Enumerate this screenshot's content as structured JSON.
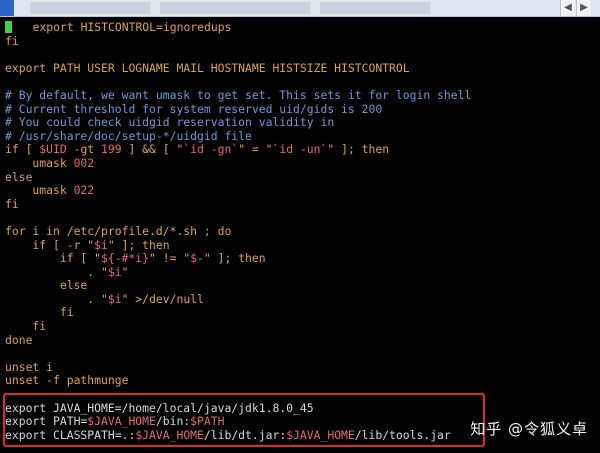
{
  "tabbar": {
    "nav_prev": "◀",
    "nav_next": "▶"
  },
  "terminal": {
    "lines": [
      [
        {
          "t": "   export HISTCONTROL=ignoredups",
          "c": "kw"
        }
      ],
      [
        {
          "t": "fi",
          "c": "kw"
        }
      ],
      [
        {
          "t": "",
          "c": "txt"
        }
      ],
      [
        {
          "t": "export PATH USER LOGNAME MAIL HOSTNAME HISTSIZE HISTCONTROL",
          "c": "kw"
        }
      ],
      [
        {
          "t": "",
          "c": "txt"
        }
      ],
      [
        {
          "t": "# By default, we want umask to get set. This sets it for login shell",
          "c": "cmt"
        }
      ],
      [
        {
          "t": "# Current threshold for system reserved uid/gids is 200",
          "c": "cmt"
        }
      ],
      [
        {
          "t": "# You could check uidgid reservation validity in",
          "c": "cmt"
        }
      ],
      [
        {
          "t": "# /usr/share/doc/setup-*/uidgid file",
          "c": "cmt"
        }
      ],
      [
        {
          "t": "if [ ",
          "c": "kw"
        },
        {
          "t": "$UID",
          "c": "var"
        },
        {
          "t": " -gt ",
          "c": "kw"
        },
        {
          "t": "199",
          "c": "num"
        },
        {
          "t": " ] && [ \"",
          "c": "kw"
        },
        {
          "t": "`id -gn`",
          "c": "str"
        },
        {
          "t": "\" = \"",
          "c": "kw"
        },
        {
          "t": "`id -un`",
          "c": "str"
        },
        {
          "t": "\" ]; then",
          "c": "kw"
        }
      ],
      [
        {
          "t": "    umask ",
          "c": "kw"
        },
        {
          "t": "002",
          "c": "num"
        }
      ],
      [
        {
          "t": "else",
          "c": "kw"
        }
      ],
      [
        {
          "t": "    umask ",
          "c": "kw"
        },
        {
          "t": "022",
          "c": "num"
        }
      ],
      [
        {
          "t": "fi",
          "c": "kw"
        }
      ],
      [
        {
          "t": "",
          "c": "txt"
        }
      ],
      [
        {
          "t": "for i in /etc/profile.d/*.sh ; do",
          "c": "kw"
        }
      ],
      [
        {
          "t": "    if [ -r \"",
          "c": "kw"
        },
        {
          "t": "$i",
          "c": "var"
        },
        {
          "t": "\" ]; then",
          "c": "kw"
        }
      ],
      [
        {
          "t": "        if [ \"",
          "c": "kw"
        },
        {
          "t": "${-#*i}",
          "c": "var"
        },
        {
          "t": "\" != \"",
          "c": "kw"
        },
        {
          "t": "$-",
          "c": "var"
        },
        {
          "t": "\" ]; then",
          "c": "kw"
        }
      ],
      [
        {
          "t": "            . \"",
          "c": "kw"
        },
        {
          "t": "$i",
          "c": "var"
        },
        {
          "t": "\"",
          "c": "kw"
        }
      ],
      [
        {
          "t": "        else",
          "c": "kw"
        }
      ],
      [
        {
          "t": "            . \"",
          "c": "kw"
        },
        {
          "t": "$i",
          "c": "var"
        },
        {
          "t": "\" >/dev/null",
          "c": "kw"
        }
      ],
      [
        {
          "t": "        fi",
          "c": "kw"
        }
      ],
      [
        {
          "t": "    fi",
          "c": "kw"
        }
      ],
      [
        {
          "t": "done",
          "c": "kw"
        }
      ],
      [
        {
          "t": "",
          "c": "txt"
        }
      ],
      [
        {
          "t": "unset i",
          "c": "kw"
        }
      ],
      [
        {
          "t": "unset -f pathmunge",
          "c": "kw"
        }
      ],
      [
        {
          "t": "",
          "c": "txt"
        }
      ],
      [
        {
          "t": "export JAVA_HOME=/home/local/java/jdk1.8.0_45",
          "c": "txt"
        }
      ],
      [
        {
          "t": "export PATH=",
          "c": "txt"
        },
        {
          "t": "$JAVA_HOME",
          "c": "var"
        },
        {
          "t": "/bin:",
          "c": "txt"
        },
        {
          "t": "$PATH",
          "c": "var"
        }
      ],
      [
        {
          "t": "export CLASSPATH=.:",
          "c": "txt"
        },
        {
          "t": "$JAVA_HOME",
          "c": "var"
        },
        {
          "t": "/lib/dt.jar:",
          "c": "txt"
        },
        {
          "t": "$JAVA_HOME",
          "c": "var"
        },
        {
          "t": "/lib/tools.jar",
          "c": "txt"
        }
      ]
    ]
  },
  "watermark": "知乎 @令狐义卓"
}
